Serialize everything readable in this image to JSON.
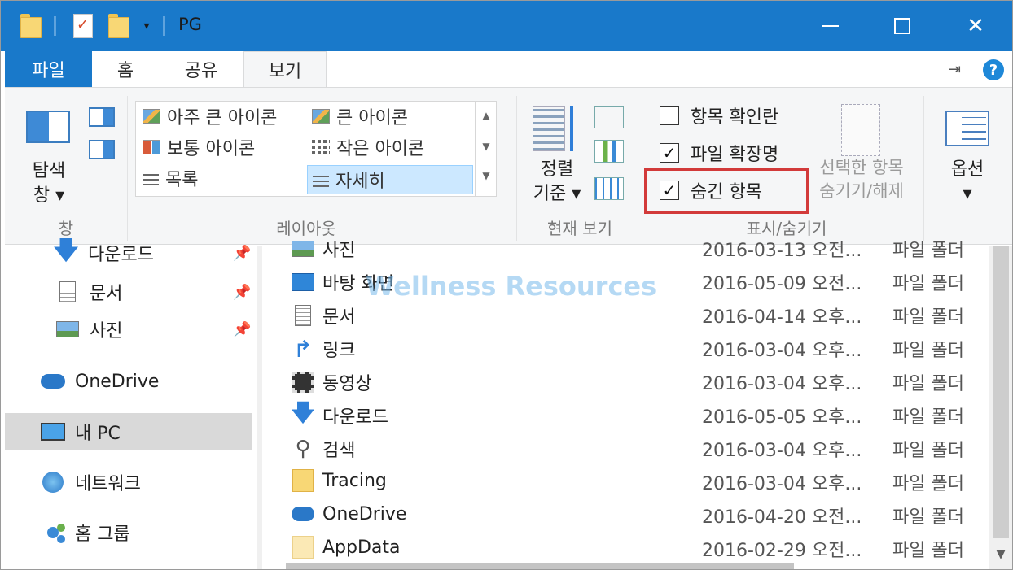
{
  "window": {
    "title": "PG",
    "controls": {
      "minimize": "—",
      "close": "✕"
    }
  },
  "tabs": {
    "file": "파일",
    "home": "홈",
    "share": "공유",
    "view": "보기"
  },
  "ribbon": {
    "pane_group": {
      "nav_pane_label_line1": "탐색",
      "nav_pane_label_line2": "창 ▾",
      "group_label": "창"
    },
    "layout_group": {
      "items": [
        "아주 큰 아이콘",
        "큰 아이콘",
        "보통 아이콘",
        "작은 아이콘",
        "목록",
        "자세히"
      ],
      "selected": "자세히",
      "group_label": "레이아웃"
    },
    "current_view_group": {
      "sort_label_line1": "정렬",
      "sort_label_line2": "기준 ▾",
      "group_label": "현재 보기"
    },
    "show_hide_group": {
      "checkboxes": [
        {
          "label": "항목 확인란",
          "checked": false
        },
        {
          "label": "파일 확장명",
          "checked": true
        },
        {
          "label": "숨긴 항목",
          "checked": true
        }
      ],
      "hide_selected_line1": "선택한 항목",
      "hide_selected_line2": "숨기기/해제",
      "group_label": "표시/숨기기"
    },
    "options": {
      "label": "옵션",
      "arrow": "▾"
    }
  },
  "nav_pane": {
    "items": [
      {
        "label": "다운로드",
        "icon": "download-arrow-icon",
        "pinned": true
      },
      {
        "label": "문서",
        "icon": "document-icon",
        "pinned": true
      },
      {
        "label": "사진",
        "icon": "picture-icon",
        "pinned": true
      },
      {
        "label": "OneDrive",
        "icon": "onedrive-icon",
        "pinned": false
      },
      {
        "label": "내 PC",
        "icon": "monitor-icon",
        "pinned": false,
        "selected": true
      },
      {
        "label": "네트워크",
        "icon": "network-icon",
        "pinned": false
      },
      {
        "label": "홈 그룹",
        "icon": "homegroup-icon",
        "pinned": false
      }
    ],
    "pin_glyph": "📌"
  },
  "files": [
    {
      "name": "사진",
      "date": "2016-03-13 오전...",
      "type": "파일 폴더",
      "icon": "picture-icon"
    },
    {
      "name": "바탕 화면",
      "date": "2016-05-09 오전...",
      "type": "파일 폴더",
      "icon": "desktop-icon"
    },
    {
      "name": "문서",
      "date": "2016-04-14 오후...",
      "type": "파일 폴더",
      "icon": "document-icon"
    },
    {
      "name": "링크",
      "date": "2016-03-04 오후...",
      "type": "파일 폴더",
      "icon": "link-arrow-icon"
    },
    {
      "name": "동영상",
      "date": "2016-03-04 오후...",
      "type": "파일 폴더",
      "icon": "film-icon"
    },
    {
      "name": "다운로드",
      "date": "2016-05-05 오후...",
      "type": "파일 폴더",
      "icon": "download-arrow-icon"
    },
    {
      "name": "검색",
      "date": "2016-03-04 오후...",
      "type": "파일 폴더",
      "icon": "magnifier-icon"
    },
    {
      "name": "Tracing",
      "date": "2016-03-04 오후...",
      "type": "파일 폴더",
      "icon": "folder-icon"
    },
    {
      "name": "OneDrive",
      "date": "2016-04-20 오전...",
      "type": "파일 폴더",
      "icon": "onedrive-icon"
    },
    {
      "name": "AppData",
      "date": "2016-02-29 오전...",
      "type": "파일 폴더",
      "icon": "folder-faded-icon"
    }
  ],
  "watermark": "Wellness Resources",
  "colors": {
    "titlebar": "#1979ca",
    "highlight": "#d23a3a",
    "selected_item": "#cce8ff"
  }
}
